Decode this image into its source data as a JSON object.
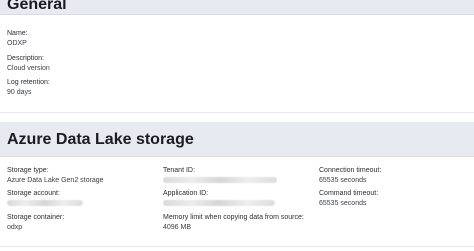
{
  "general": {
    "title": "General",
    "name_label": "Name:",
    "name_value": "ODXP",
    "description_label": "Description:",
    "description_value": "Cloud version",
    "log_retention_label": "Log retention:",
    "log_retention_value": "90 days"
  },
  "storage": {
    "title": "Azure Data Lake storage",
    "storage_type_label": "Storage type:",
    "storage_type_value": "Azure Data Lake Gen2 storage",
    "storage_account_label": "Storage account:",
    "storage_container_label": "Storage container:",
    "storage_container_value": "odxp",
    "tenant_id_label": "Tenant ID:",
    "application_id_label": "Application ID:",
    "memory_limit_label": "Memory limit when copying data from source:",
    "memory_limit_value": "4096 MB",
    "connection_timeout_label": "Connection timeout:",
    "connection_timeout_value": "65535 seconds",
    "command_timeout_label": "Command timeout:",
    "command_timeout_value": "65535 seconds"
  },
  "colors": {
    "section_header_bg": "#e8eaf1",
    "text": "#1f2329"
  }
}
